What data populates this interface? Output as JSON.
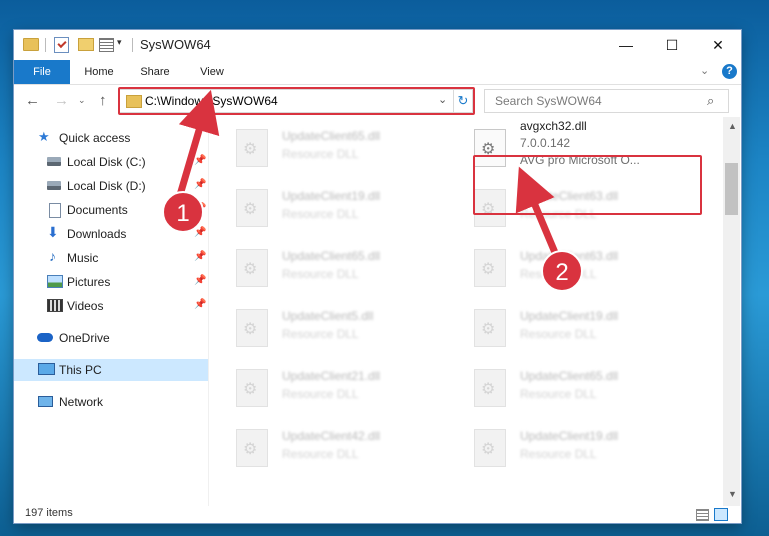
{
  "window": {
    "title": "SysWOW64",
    "minimize": "—",
    "maximize": "☐",
    "close": "✕"
  },
  "ribbon": {
    "tabs": [
      "File",
      "Home",
      "Share",
      "View"
    ],
    "expand": "⌄",
    "help": "?"
  },
  "nav": {
    "back": "←",
    "forward": "→",
    "recent": "⌄",
    "up": "↑",
    "address": "C:\\Windows\\SysWOW64",
    "address_dropdown": "⌄",
    "refresh": "↻",
    "search_placeholder": "Search SysWOW64",
    "search_icon": "⌕"
  },
  "sidebar": {
    "items": [
      {
        "label": "Quick access",
        "icon": "star-icon",
        "glyph": "★",
        "pinned": false
      },
      {
        "label": "Local Disk (C:)",
        "icon": "drive-icon",
        "glyph": "",
        "pinned": true
      },
      {
        "label": "Local Disk (D:)",
        "icon": "drive-icon",
        "glyph": "",
        "pinned": true
      },
      {
        "label": "Documents",
        "icon": "documents-icon",
        "glyph": "",
        "pinned": true
      },
      {
        "label": "Downloads",
        "icon": "downloads-icon",
        "glyph": "⬇",
        "pinned": true
      },
      {
        "label": "Music",
        "icon": "music-icon",
        "glyph": "♪",
        "pinned": true
      },
      {
        "label": "Pictures",
        "icon": "pictures-icon",
        "glyph": "",
        "pinned": true
      },
      {
        "label": "Videos",
        "icon": "videos-icon",
        "glyph": "",
        "pinned": true
      },
      {
        "label": "OneDrive",
        "icon": "onedrive-icon",
        "glyph": "",
        "pinned": false
      },
      {
        "label": "This PC",
        "icon": "this-pc-icon",
        "glyph": "",
        "pinned": false,
        "selected": true
      },
      {
        "label": "Network",
        "icon": "network-icon",
        "glyph": "",
        "pinned": false
      }
    ],
    "pin_glyph": "📌"
  },
  "files": {
    "left_column": [
      {
        "name": "UpdateClient65.dll",
        "desc": "Resource DLL"
      },
      {
        "name": "UpdateClient19.dll",
        "desc": "Resource DLL"
      },
      {
        "name": "UpdateClient65.dll",
        "desc": "Resource DLL"
      },
      {
        "name": "UpdateClient5.dll",
        "desc": "Resource DLL"
      },
      {
        "name": "UpdateClient21.dll",
        "desc": "Resource DLL"
      },
      {
        "name": "UpdateClient42.dll",
        "desc": "Resource DLL"
      }
    ],
    "right_column": [
      {
        "name": "avgxch32.dll",
        "version": "7.0.0.142",
        "desc": "AVG pro Microsoft O..."
      },
      {
        "name": "UpdateClient63.dll",
        "desc": "Resource DLL"
      },
      {
        "name": "UpdateClient63.dll",
        "desc": "Resource DLL"
      },
      {
        "name": "UpdateClient19.dll",
        "desc": "Resource DLL"
      },
      {
        "name": "UpdateClient65.dll",
        "desc": "Resource DLL"
      },
      {
        "name": "UpdateClient19.dll",
        "desc": "Resource DLL"
      }
    ]
  },
  "status": {
    "items_count": "197 items"
  },
  "annotations": {
    "step1": "1",
    "step2": "2",
    "color": "#d9333f"
  }
}
